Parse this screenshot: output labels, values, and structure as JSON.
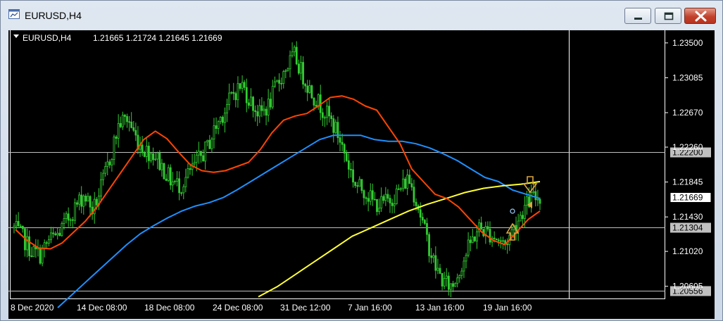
{
  "window": {
    "title": "EURUSD,H4",
    "buttons": {
      "minimize": "minimize",
      "maximize": "maximize",
      "close": "close"
    }
  },
  "chart": {
    "symbol_header": "EURUSD,H4",
    "ohlc_text": "1.21665 1.21724 1.21645 1.21669",
    "y_ticks": [
      "1.23500",
      "1.23085",
      "1.22670",
      "1.22260",
      "1.21845",
      "1.21430",
      "1.21020",
      "1.20605"
    ],
    "x_ticks": [
      "8 Dec 2020",
      "14 Dec 08:00",
      "18 Dec 08:00",
      "24 Dec 08:00",
      "31 Dec 12:00",
      "7 Jan 16:00",
      "13 Jan 16:00",
      "19 Jan 16:00"
    ],
    "hlines": [
      {
        "price": 1.222,
        "label": "1.22200"
      },
      {
        "price": 1.21304,
        "label": "1.21304"
      },
      {
        "price": 1.20556,
        "label": "1.20556"
      }
    ],
    "current_price": {
      "price": 1.21669,
      "label": "1.21669"
    },
    "colors": {
      "background": "#000000",
      "candles": "#33cc33",
      "ma_fast": "#ff4500",
      "ma_mid": "#1e90ff",
      "ma_slow": "#ffff33",
      "arrows": "#d9a441"
    }
  },
  "chart_data": {
    "type": "candlestick",
    "title": "EURUSD,H4",
    "ylim": [
      1.2046,
      1.2365
    ],
    "y_ticks": [
      1.235,
      1.23085,
      1.2267,
      1.2226,
      1.21845,
      1.2143,
      1.2102,
      1.20605
    ],
    "x_ticks": [
      "8 Dec 2020",
      "14 Dec 08:00",
      "18 Dec 08:00",
      "24 Dec 08:00",
      "31 Dec 12:00",
      "7 Jan 16:00",
      "13 Jan 16:00",
      "19 Jan 16:00"
    ],
    "close_series": [
      1.213,
      1.2118,
      1.2102,
      1.2098,
      1.2115,
      1.2122,
      1.2138,
      1.2155,
      1.217,
      1.215,
      1.218,
      1.2215,
      1.2255,
      1.226,
      1.2235,
      1.2222,
      1.2218,
      1.22,
      1.2185,
      1.218,
      1.2195,
      1.221,
      1.2225,
      1.225,
      1.227,
      1.229,
      1.23,
      1.228,
      1.2265,
      1.2275,
      1.23,
      1.232,
      1.2335,
      1.231,
      1.229,
      1.2275,
      1.226,
      1.224,
      1.221,
      1.218,
      1.2175,
      1.216,
      1.2158,
      1.2165,
      1.2175,
      1.219,
      1.216,
      1.212,
      1.2085,
      1.2065,
      1.206,
      1.2085,
      1.211,
      1.213,
      1.2125,
      1.2118,
      1.211,
      1.213,
      1.215,
      1.2165,
      1.2167
    ],
    "series": [
      {
        "name": "ma_fast",
        "values": [
          1.2128,
          1.2115,
          1.2106,
          1.2105,
          1.2112,
          1.2125,
          1.2138,
          1.2155,
          1.2175,
          1.2195,
          1.2215,
          1.2235,
          1.2245,
          1.2236,
          1.222,
          1.2205,
          1.2198,
          1.2196,
          1.2198,
          1.2203,
          1.2208,
          1.2223,
          1.2243,
          1.2258,
          1.2263,
          1.2266,
          1.2275,
          1.2285,
          1.2287,
          1.2283,
          1.2275,
          1.227,
          1.225,
          1.223,
          1.22,
          1.2185,
          1.217,
          1.2165,
          1.2155,
          1.214,
          1.2125,
          1.2115,
          1.211,
          1.2125,
          1.214,
          1.215
        ]
      },
      {
        "name": "ma_mid",
        "values": [
          1.2035,
          1.205,
          1.2065,
          1.208,
          1.2095,
          1.211,
          1.2123,
          1.2133,
          1.2142,
          1.215,
          1.2156,
          1.216,
          1.2166,
          1.2175,
          1.2185,
          1.2195,
          1.2205,
          1.2215,
          1.2225,
          1.2235,
          1.224,
          1.224,
          1.224,
          1.2235,
          1.2233,
          1.2233,
          1.223,
          1.2225,
          1.2218,
          1.221,
          1.22,
          1.219,
          1.2185,
          1.2175,
          1.217,
          1.2165
        ]
      },
      {
        "name": "ma_slow",
        "values": [
          1.2048,
          1.206,
          1.2075,
          1.209,
          1.2105,
          1.212,
          1.213,
          1.214,
          1.215,
          1.2158,
          1.2165,
          1.2172,
          1.2177,
          1.218,
          1.2182,
          1.2185
        ]
      }
    ]
  }
}
